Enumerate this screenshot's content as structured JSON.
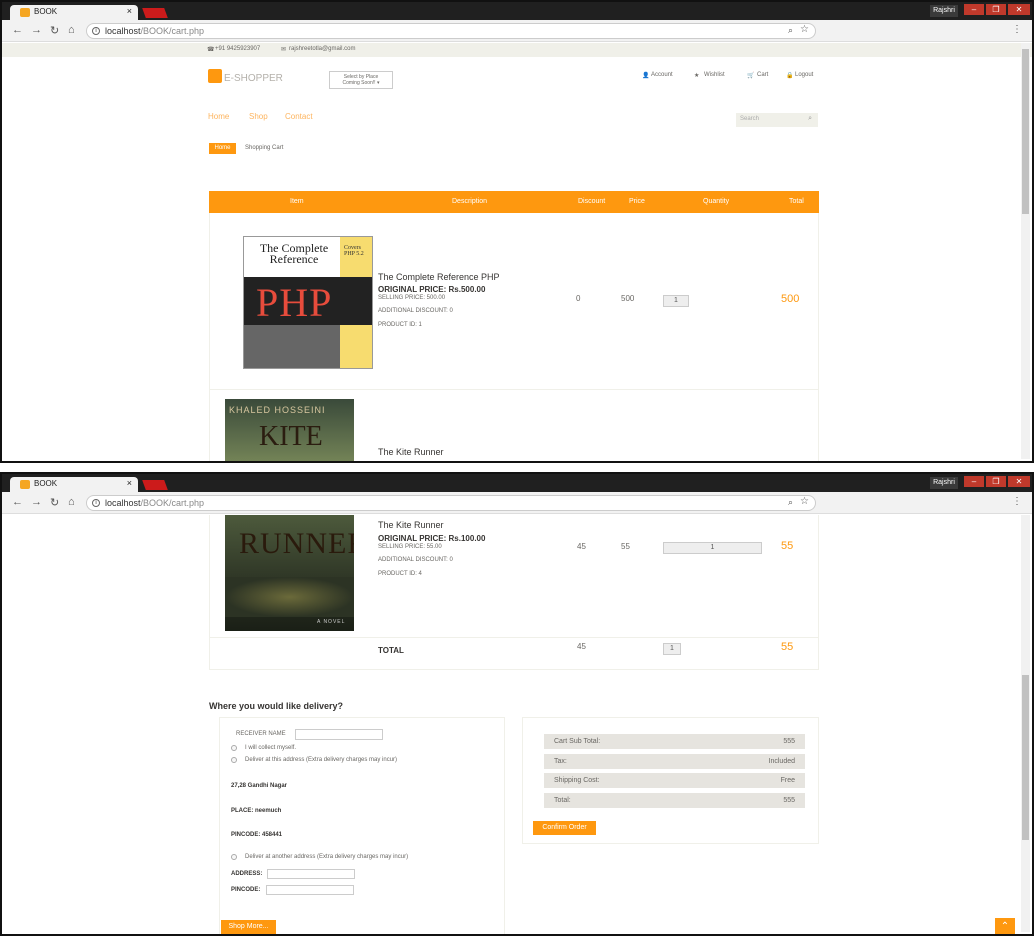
{
  "browser": {
    "tab_title": "BOOK",
    "tab_close": "×",
    "profile_name": "Rajshri",
    "url_host": "localhost",
    "url_path": "/BOOK/cart.php",
    "window_minimize": "–",
    "window_maximize": "❐",
    "window_close": "✕"
  },
  "header": {
    "phone": "+91 9425923907",
    "email": "rajshreetotla@gmail.com",
    "brand": "E-SHOPPER",
    "place_line1": "Select by Place",
    "place_line2": "Coming Soon!! ▾",
    "account_links": [
      "Account",
      "Wishlist",
      "Cart",
      "Logout"
    ]
  },
  "nav": {
    "links": [
      "Home",
      "Shop",
      "Contact"
    ],
    "search_placeholder": "Search"
  },
  "breadcrumb": {
    "home": "Home",
    "current": "Shopping Cart"
  },
  "cart": {
    "columns": [
      "Item",
      "Description",
      "Discount",
      "Price",
      "Quantity",
      "Total"
    ],
    "items": [
      {
        "cover_title": "The Complete Reference",
        "cover_badge": "Covers PHP 5.2",
        "cover_big": "PHP",
        "name": "The Complete Reference PHP",
        "original_price": "ORIGINAL PRICE: Rs.500.00",
        "selling_price": "SELLING PRICE: 500.00",
        "additional_discount": "ADDITIONAL DISCOUNT: 0",
        "product_id": "PRODUCT ID: 1",
        "discount": "0",
        "price": "500",
        "quantity": "1",
        "total": "500"
      },
      {
        "cover_author": "KHALED HOSSEINI",
        "cover_title_top": "KITE",
        "cover_title_bottom": "RUNNER",
        "cover_footer": "A NOVEL",
        "name": "The Kite Runner",
        "original_price": "ORIGINAL PRICE: Rs.100.00",
        "selling_price": "SELLING PRICE: 55.00",
        "additional_discount": "ADDITIONAL DISCOUNT: 0",
        "product_id": "PRODUCT ID: 4",
        "discount": "45",
        "price": "55",
        "quantity": "1",
        "total": "55"
      }
    ],
    "total_row": {
      "label": "TOTAL",
      "discount": "45",
      "quantity": "1",
      "total": "55"
    }
  },
  "delivery": {
    "heading": "Where you would like delivery?",
    "receiver_label": "RECEIVER NAME",
    "option_self": "I will collect myself.",
    "option_this_address": "Deliver at this address (Extra delivery charges may incur)",
    "address_line": "27,28 Gandhi Nagar",
    "place": "PLACE: neemuch",
    "pincode": "PINCODE: 458441",
    "option_other_address": "Deliver at another address (Extra delivery charges may incur)",
    "address_label": "ADDRESS:",
    "pincode_label": "PINCODE:",
    "shop_more": "Shop More..."
  },
  "summary": {
    "rows": [
      {
        "label": "Cart Sub Total:",
        "value": "555"
      },
      {
        "label": "Tax:",
        "value": "Included"
      },
      {
        "label": "Shipping Cost:",
        "value": "Free"
      },
      {
        "label": "Total:",
        "value": "555"
      }
    ],
    "confirm": "Confirm Order"
  },
  "colors": {
    "accent": "#fe980f",
    "chrome_dark": "#202020",
    "window_buttons": "#c0392b"
  }
}
